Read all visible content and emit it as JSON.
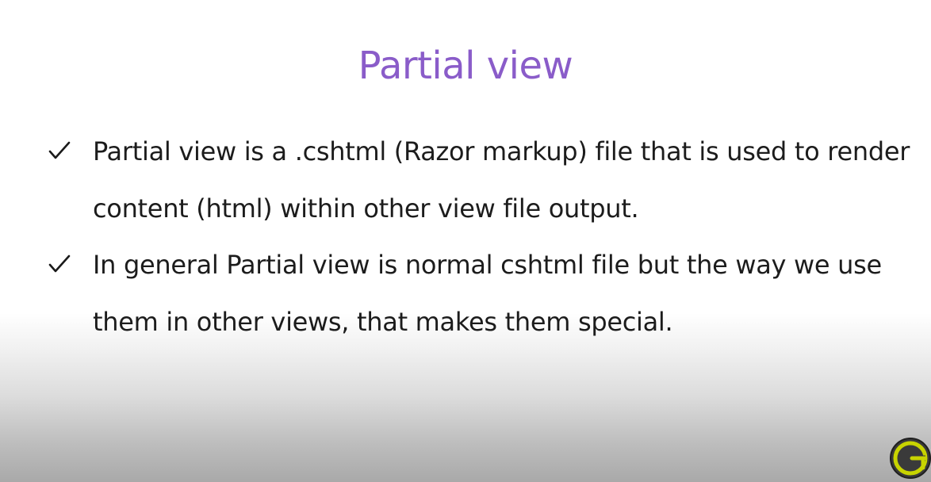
{
  "slide": {
    "title": "Partial view",
    "bullets": [
      {
        "lines": [
          "Partial view is a .cshtml (Razor markup) file that is used to render",
          "content (html) within other view file output."
        ]
      },
      {
        "lines": [
          "In general Partial view is normal cshtml file but the way we use",
          "them in other views, that makes them special."
        ]
      }
    ],
    "bullet_icon": "checkmark-icon",
    "logo_icon": "g-logo-icon",
    "colors": {
      "title": "#8a5cc9",
      "text": "#1c1c1c",
      "logo_ring": "#2f2f2f",
      "logo_accent": "#c8d400"
    }
  }
}
